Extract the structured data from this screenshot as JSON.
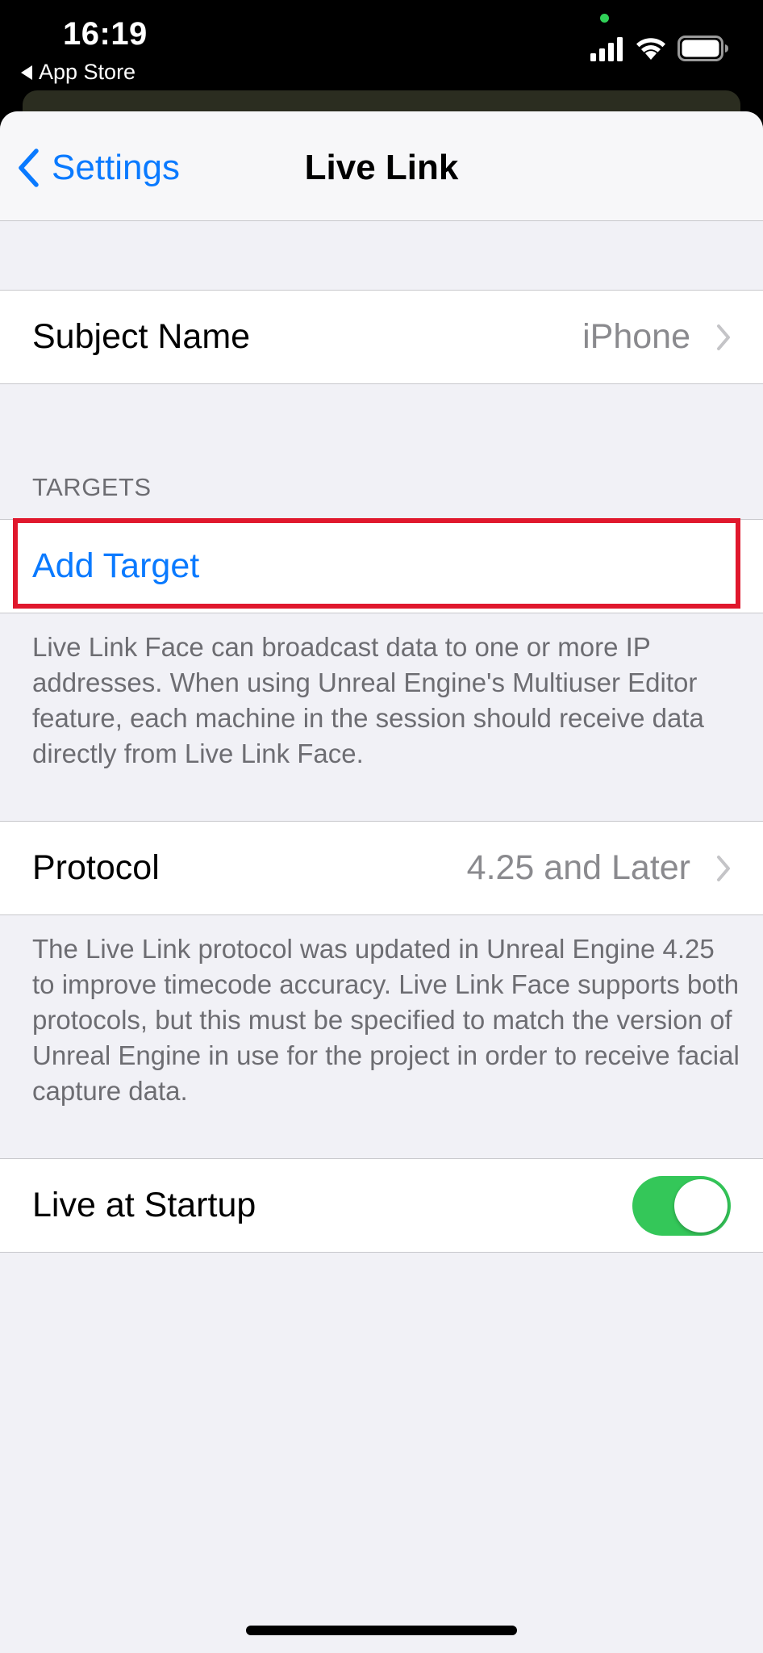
{
  "status_bar": {
    "time": "16:19",
    "back_app": "App Store",
    "dot_color": "#30d158"
  },
  "navbar": {
    "back_label": "Settings",
    "title": "Live Link"
  },
  "subject_row": {
    "label": "Subject Name",
    "value": "iPhone"
  },
  "targets": {
    "header": "TARGETS",
    "add_label": "Add Target",
    "footer": "Live Link Face can broadcast data to one or more IP addresses. When using Unreal Engine's Multiuser Editor feature, each machine in the session should receive data directly from Live Link Face."
  },
  "protocol": {
    "label": "Protocol",
    "value": "4.25 and Later",
    "footer": "The Live Link protocol was updated in Unreal Engine 4.25 to improve timecode accuracy.  Live Link Face supports both protocols, but this must be specified to match the version of Unreal Engine in use for the project in order to receive facial capture data."
  },
  "startup": {
    "label": "Live at Startup",
    "toggle_on": true
  },
  "colors": {
    "accent": "#0a7aff",
    "toggle": "#34c759",
    "highlight": "#e0182d",
    "background": "#f1f1f6"
  },
  "icons": {
    "back": "chevron-left-icon",
    "disclosure": "chevron-right-icon",
    "signal": "cellular-signal-icon",
    "wifi": "wifi-icon",
    "battery": "battery-icon"
  }
}
